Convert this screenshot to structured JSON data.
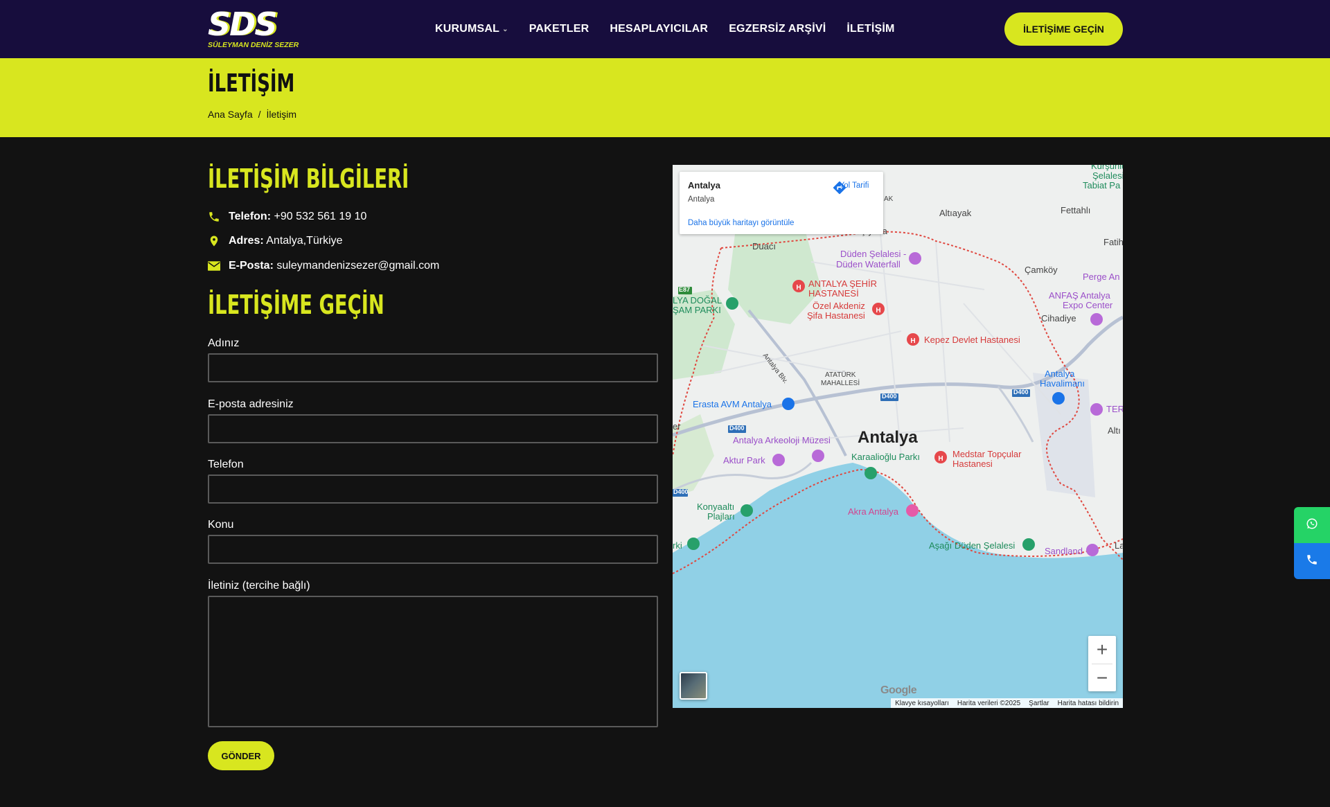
{
  "brand": {
    "logo_mark": "SDS",
    "logo_sub": "SÜLEYMAN DENİZ SEZER",
    "accent": "#d8e61f",
    "header_bg": "#170d3d"
  },
  "nav": {
    "items": [
      {
        "label": "KURUMSAL",
        "has_dropdown": true
      },
      {
        "label": "PAKETLER"
      },
      {
        "label": "HESAPLAYICILAR"
      },
      {
        "label": "EGZERSİZ ARŞİVİ"
      },
      {
        "label": "İLETİŞİM"
      }
    ],
    "cta_label": "İLETİŞİME GEÇİN"
  },
  "page": {
    "title": "İLETİŞİM",
    "breadcrumb": {
      "home": "Ana Sayfa",
      "separator": "/",
      "current": "İletişim"
    }
  },
  "contact_info": {
    "heading": "İLETİŞİM BİLGİLERİ",
    "phone_label": "Telefon:",
    "phone_value": "+90 532 561 19 10",
    "address_label": "Adres:",
    "address_value": "Antalya,Türkiye",
    "email_label": "E-Posta:",
    "email_value": "suleymandenizsezer@gmail.com"
  },
  "form": {
    "heading": "İLETİŞİME GEÇİN",
    "name_label": "Adınız",
    "email_label": "E-posta adresiniz",
    "phone_label": "Telefon",
    "subject_label": "Konu",
    "message_label": "İletiniz (tercihe bağlı)",
    "submit_label": "GÖNDER"
  },
  "map": {
    "card_title": "Antalya",
    "card_subtitle": "Antalya",
    "directions_label": "Yol Tarifi",
    "larger_map_link": "Daha büyük haritayı görüntüle",
    "city_label": "Antalya",
    "google_label": "Google",
    "footer": {
      "shortcuts": "Klavye kısayolları",
      "data": "Harita verileri ©2025",
      "terms": "Şartlar",
      "report": "Harita hatası bildirin"
    },
    "labels": {
      "altiyayak": "Altıayak",
      "fettahli": "Fettahlı",
      "fatih": "Fatih",
      "karsiyaka": "Karşıyaka",
      "arsak": "arsak",
      "duaci": "Duacı",
      "camkoy": "Çamköy",
      "perge": "Perge An",
      "duden_selalesi": "Düden Şelalesi -",
      "duden_waterfall": "Düden Waterfall",
      "kursunlu1": "Kurşunlu",
      "kursunlu2": "Şelalesi",
      "kursunlu3": "Tabiat Pa",
      "sehir_hastanesi1": "ANTALYA ŞEHİR",
      "sehir_hastanesi2": "HASTANESİ",
      "dogal_park1": "LYA DOĞAL",
      "dogal_park2": "ŞAM PARKI",
      "ozel_akdeniz1": "Özel Akdeniz",
      "ozel_akdeniz2": "Şifa Hastanesi",
      "anfas1": "ANFAŞ Antalya",
      "anfas2": "Expo Center",
      "cihadiye": "Cihadiye",
      "kepez": "Kepez Devlet Hastanesi",
      "ataturk1": "ATATÜRK",
      "ataturk2": "MAHALLESİ",
      "airport1": "Antalya",
      "airport2": "Havalimanı",
      "erasta": "Erasta AVM Antalya",
      "ter": "TER",
      "alti": "Altı",
      "arkeoloji": "Antalya Arkeoloji Müzesi",
      "aktur": "Aktur Park",
      "karaalioglu": "Karaalioğlu Parkı",
      "medstar1": "Medstar Topçular",
      "medstar2": "Hastanesi",
      "konyaalti1": "Konyaaltı",
      "konyaalti2": "Plajları",
      "akra": "Akra Antalya",
      "asagi_duden": "Aşağı Düden Şelalesi",
      "sandland": "Sandland",
      "rki": "rki",
      "la": "La",
      "er": "er",
      "ak": "AK",
      "road_d400": "D400",
      "road_e87": "E87",
      "road_antalya_blv": "Antalya Blv."
    }
  }
}
